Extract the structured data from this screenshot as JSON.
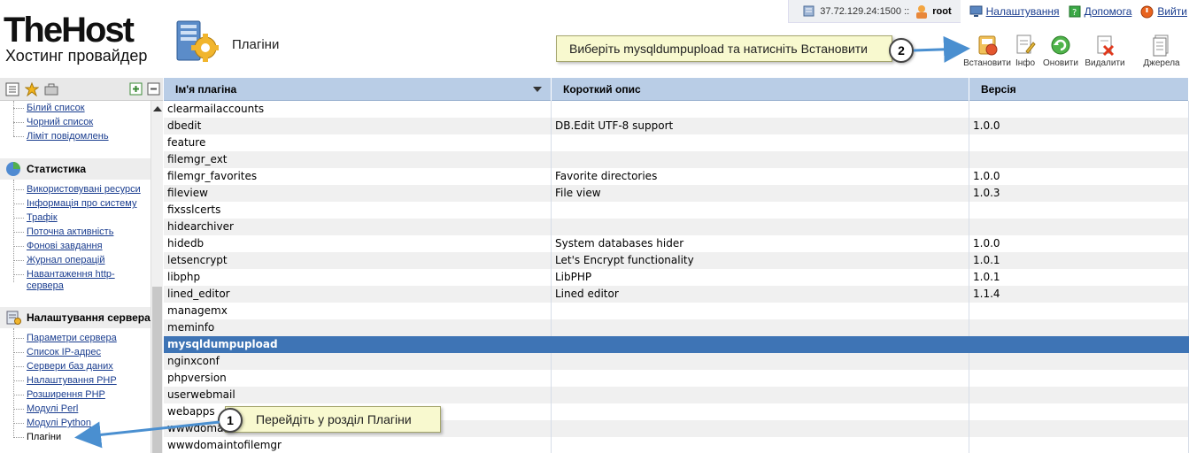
{
  "header": {
    "logo_brand": "TheHost",
    "logo_tagline": "Хостинг провайдер",
    "page_title": "Плагіни"
  },
  "topbar": {
    "server_ip": "37.72.129.24:1500 ::",
    "user": "root",
    "settings": "Налаштування",
    "help": "Допомога",
    "logout": "Вийти"
  },
  "toolbar": {
    "install": "Встановити",
    "info": "Інфо",
    "update": "Оновити",
    "delete": "Видалити",
    "sources": "Джерела"
  },
  "callouts": {
    "step1_number": "1",
    "step1_text": "Перейдіть у розділ Плагіни",
    "step2_number": "2",
    "step2_text": "Виберіть mysqldumpupload та натисніть Встановити"
  },
  "sidebar": {
    "top_links": [
      "Білий список",
      "Чорний список",
      "Ліміт повідомлень"
    ],
    "stats_title": "Статистика",
    "stats_links": [
      "Використовувані ресурси",
      "Інформація про систему",
      "Трафік",
      "Поточна активність",
      "Фонові завдання",
      "Журнал операцій",
      "Навантаження http-",
      "сервера"
    ],
    "server_title": "Налаштування сервера",
    "server_links": [
      "Параметри сервера",
      "Список IP-адрес",
      "Сервери баз даних",
      "Налаштування PHP",
      "Розширення PHP",
      "Модулі Perl",
      "Модулі Python",
      "Плагіни"
    ]
  },
  "table": {
    "columns": [
      "Ім'я плагіна",
      "Короткий опис",
      "Версія"
    ],
    "rows": [
      {
        "name": "clearmailaccounts",
        "desc": "",
        "ver": ""
      },
      {
        "name": "dbedit",
        "desc": "DB.Edit UTF-8 support",
        "ver": "1.0.0"
      },
      {
        "name": "feature",
        "desc": "",
        "ver": ""
      },
      {
        "name": "filemgr_ext",
        "desc": "",
        "ver": ""
      },
      {
        "name": "filemgr_favorites",
        "desc": "Favorite directories",
        "ver": "1.0.0"
      },
      {
        "name": "fileview",
        "desc": "File view",
        "ver": "1.0.3"
      },
      {
        "name": "fixsslcerts",
        "desc": "",
        "ver": ""
      },
      {
        "name": "hidearchiver",
        "desc": "",
        "ver": ""
      },
      {
        "name": "hidedb",
        "desc": "System databases hider",
        "ver": "1.0.0"
      },
      {
        "name": "letsencrypt",
        "desc": "Let's Encrypt functionality",
        "ver": "1.0.1"
      },
      {
        "name": "libphp",
        "desc": "LibPHP",
        "ver": "1.0.1"
      },
      {
        "name": "lined_editor",
        "desc": "Lined editor",
        "ver": "1.1.4"
      },
      {
        "name": "managemx",
        "desc": "",
        "ver": ""
      },
      {
        "name": "meminfo",
        "desc": "",
        "ver": ""
      },
      {
        "name": "mysqldumpupload",
        "desc": "",
        "ver": ""
      },
      {
        "name": "nginxconf",
        "desc": "",
        "ver": ""
      },
      {
        "name": "phpversion",
        "desc": "",
        "ver": ""
      },
      {
        "name": "userwebmail",
        "desc": "",
        "ver": ""
      },
      {
        "name": "webapps",
        "desc": "",
        "ver": ""
      },
      {
        "name": "wwwdomain",
        "desc": "",
        "ver": ""
      },
      {
        "name": "wwwdomaintofilemgr",
        "desc": "",
        "ver": ""
      }
    ],
    "selected_row": 14
  },
  "colors": {
    "header_bg": "#b9cde6",
    "selected_row": "#3e74b5",
    "link": "#1a3d8f",
    "callout_bg": "#f8f9cf",
    "annotation_arrow": "#4a8fd0"
  }
}
